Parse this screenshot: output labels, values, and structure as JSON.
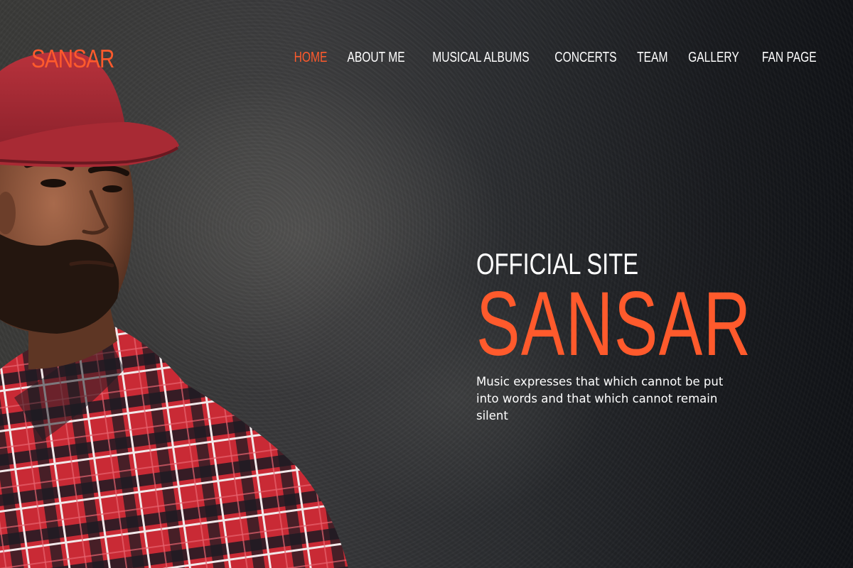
{
  "brand": {
    "logo": "SANSAR",
    "accent": "#ff5a2c"
  },
  "nav": {
    "items": [
      {
        "label": "HOME",
        "active": true
      },
      {
        "label": "ABOUT ME",
        "active": false
      },
      {
        "label": "MUSICAL ALBUMS",
        "active": false
      },
      {
        "label": "CONCERTS",
        "active": false
      },
      {
        "label": "TEAM",
        "active": false
      },
      {
        "label": "GALLERY",
        "active": false
      },
      {
        "label": "FAN PAGE",
        "active": false
      }
    ]
  },
  "hero": {
    "eyebrow": "OFFICIAL SITE",
    "title": "SANSAR",
    "tagline": "Music expresses that which cannot be put into words and that which cannot remain silent"
  }
}
